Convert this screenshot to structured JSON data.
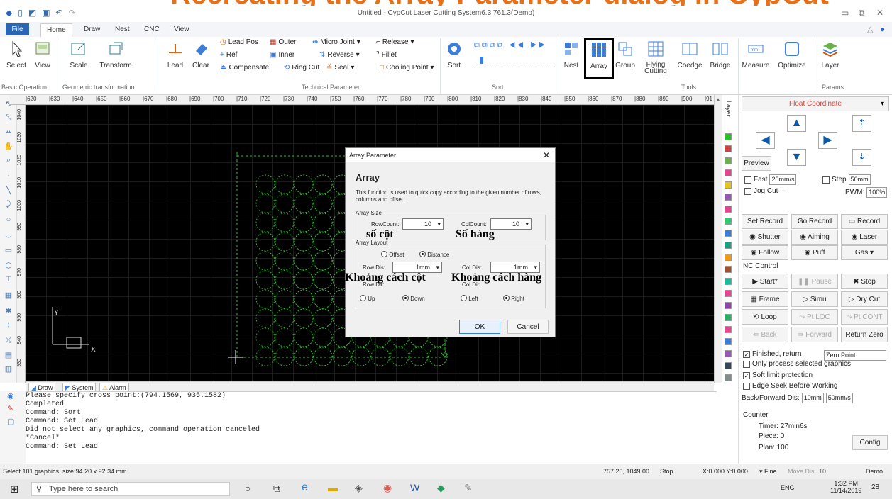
{
  "banner": {
    "text": "Recreating the Array Parameter dialog in CypCut"
  },
  "titlebar": {
    "title": "Untitled - CypCut Laser Cutting System6.3.761.3(Demo)"
  },
  "menu": {
    "file": "File",
    "tabs": [
      "Home",
      "Draw",
      "Nest",
      "CNC",
      "View"
    ]
  },
  "ribbon": {
    "select": "Select",
    "view": "View",
    "scale": "Scale",
    "transform": "Transform",
    "lead": "Lead",
    "clear": "Clear",
    "tech": [
      "Lead Pos",
      "Outer",
      "Micro Joint",
      "Release",
      "Ref",
      "Inner",
      "Reverse",
      "Fillet",
      "Compensate",
      "Ring Cut",
      "Seal",
      "Cooling Point"
    ],
    "sort": "Sort",
    "nest": "Nest",
    "array": "Array",
    "group": "Group",
    "flying": "Flying Cutting",
    "coedge": "Coedge",
    "bridge": "Bridge",
    "measure": "Measure",
    "optimize": "Optimize",
    "layer": "Layer",
    "groups": [
      "Basic Operation",
      "Geometric transformation",
      "Technical Parameter",
      "Sort",
      "Tools",
      "Params"
    ]
  },
  "ruler": {
    "ticks": [
      "620",
      "630",
      "640",
      "650",
      "660",
      "670",
      "680",
      "690",
      "700",
      "710",
      "720",
      "730",
      "740",
      "750",
      "760",
      "770",
      "780",
      "790",
      "800",
      "810",
      "820",
      "830",
      "840",
      "850",
      "860",
      "870",
      "880",
      "890",
      "900",
      "91"
    ],
    "left": [
      "1040",
      "1030",
      "1020",
      "1010",
      "1000",
      "990",
      "980",
      "970",
      "960",
      "950",
      "940",
      "930"
    ]
  },
  "canvas": {
    "y": "Y",
    "x": "X"
  },
  "tabs": {
    "draw": "Draw",
    "system": "System",
    "alarm": "Alarm"
  },
  "console": [
    "Please specify cross point:(794.1569, 935.1582)",
    "Completed",
    "Command: Sort",
    "Command: Set Lead",
    "Did not select any graphics, command operation canceled",
    "*Cancel*",
    "Command: Set Lead"
  ],
  "dialog": {
    "title": "Array Parameter",
    "heading": "Array",
    "desc": "This function is used to quick copy according to the given number of rows, columns and offset.",
    "size_label": "Array Size",
    "rowcount_label": "RowCount:",
    "rowcount": "10",
    "colcount_label": "ColCount:",
    "colcount": "10",
    "layout_label": "Array Layout",
    "offset": "Offset",
    "distance": "Distance",
    "rowdis_label": "Row Dis:",
    "rowdis": "1mm",
    "coldis_label": "Col Dis:",
    "coldis": "1mm",
    "rowdir_label": "Row Dir:",
    "up": "Up",
    "down": "Down",
    "coldir_label": "Col Dir:",
    "left": "Left",
    "right": "Right",
    "ok": "OK",
    "cancel": "Cancel"
  },
  "annotations": {
    "so_cot": "số cột",
    "so_hang": "Số hàng",
    "kc_cot": "Khoảng cách cột",
    "kc_hang": "Khoảng cách hàng"
  },
  "panel": {
    "float": "Float Coordinate",
    "preview": "Preview",
    "fast": "Fast",
    "fast_val": "20mm/s",
    "step": "Step",
    "step_val": "50mm",
    "jog": "Jog Cut",
    "pwm": "PWM:",
    "pwm_val": "100%",
    "buttons": [
      "Set Record",
      "Go Record",
      "Record",
      "Shutter",
      "Aiming",
      "Laser",
      "Follow",
      "Puff",
      "Gas"
    ],
    "nc": "NC Control",
    "nc_buttons": [
      "Start*",
      "Pause",
      "Stop",
      "Frame",
      "Simu",
      "Dry Cut",
      "Loop",
      "Pt LOC",
      "Pt CONT",
      "Back",
      "Forward",
      "Return Zero"
    ],
    "finished": "Finished, return",
    "zero_point": "Zero Point",
    "only": "Only process selected graphics",
    "soft": "Soft limit protection",
    "edge": "Edge Seek Before Working",
    "bf": "Back/Forward Dis:",
    "bf_val": "10mm",
    "bf_speed": "50mm/s",
    "counter": "Counter",
    "timer": "Timer: 27min6s",
    "piece": "Piece: 0",
    "plan": "Plan: 100",
    "config": "Config",
    "layer_tab": "Layer"
  },
  "status": {
    "left": "Select 101 graphics, size:94.20 x 92.34 mm",
    "coords": "757.20, 1049.00",
    "state": "Stop",
    "xy": "X:0.000 Y:0.000",
    "fine": "Fine",
    "move": "Move Dis",
    "move_val": "10",
    "demo": "Demo"
  },
  "taskbar": {
    "search": "Type here to search",
    "time": "1:32 PM",
    "date": "11/14/2019",
    "lang": "ENG",
    "notif": "28"
  },
  "colors": {
    "accent": "#2b66b5",
    "banner": "#e8701a",
    "canvas": "#000000",
    "green": "#22c522"
  }
}
